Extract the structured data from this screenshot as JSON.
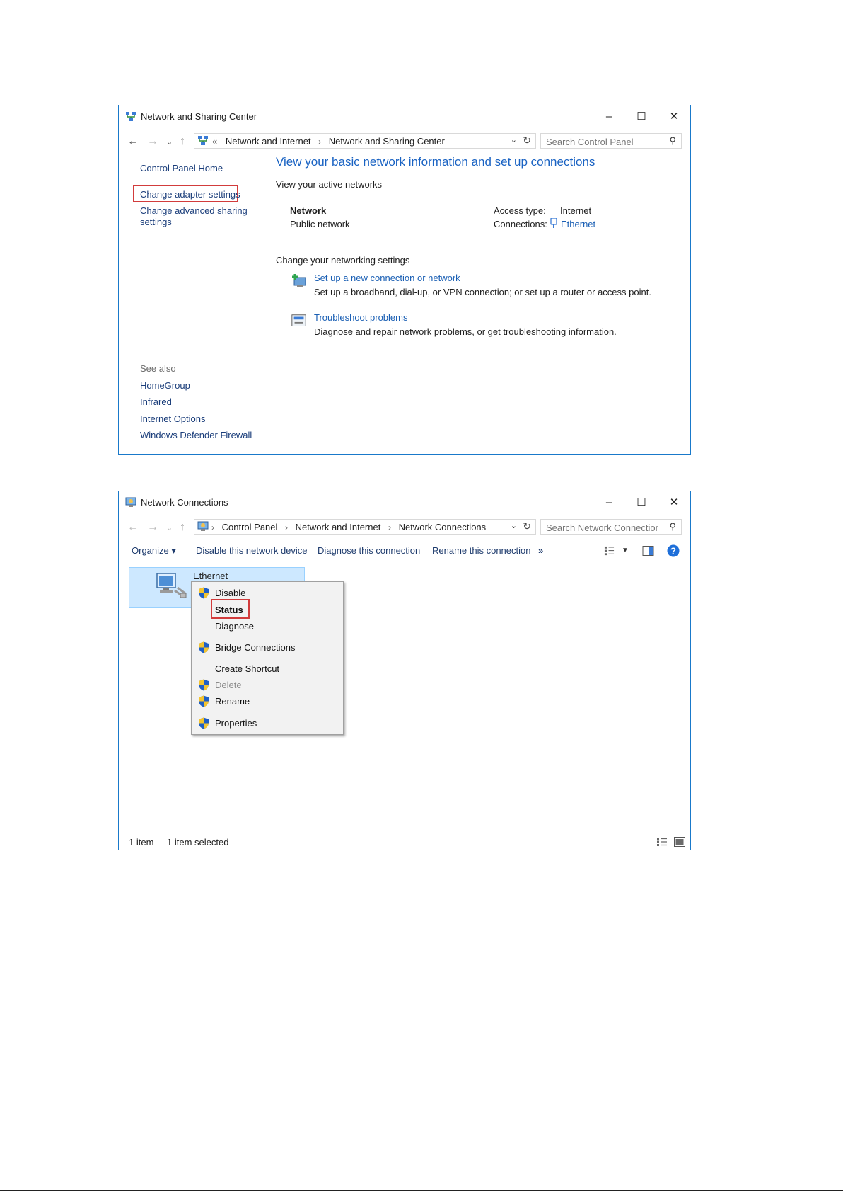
{
  "window1": {
    "title": "Network and Sharing Center",
    "breadcrumb_prefix": "«",
    "breadcrumb": [
      "Network and Internet",
      "Network and Sharing Center"
    ],
    "search_placeholder": "Search Control Panel",
    "left_nav": {
      "home": "Control Panel Home",
      "change_adapter": "Change adapter settings",
      "change_advanced_line1": "Change advanced sharing",
      "change_advanced_line2": "settings"
    },
    "see_also": {
      "label": "See also",
      "items": [
        "HomeGroup",
        "Infrared",
        "Internet Options",
        "Windows Defender Firewall"
      ]
    },
    "main_heading": "View your basic network information and set up connections",
    "active_networks_label": "View your active networks",
    "network": {
      "name": "Network",
      "type": "Public network",
      "access_type_label": "Access type:",
      "access_type_value": "Internet",
      "connections_label": "Connections:",
      "connections_value": "Ethernet"
    },
    "change_settings_label": "Change your networking settings",
    "tasks": [
      {
        "title": "Set up a new connection or network",
        "desc": "Set up a broadband, dial-up, or VPN connection; or set up a router or access point."
      },
      {
        "title": "Troubleshoot problems",
        "desc": "Diagnose and repair network problems, or get troubleshooting information."
      }
    ]
  },
  "window2": {
    "title": "Network Connections",
    "breadcrumb": [
      "Control Panel",
      "Network and Internet",
      "Network Connections"
    ],
    "search_placeholder": "Search Network Connections",
    "toolbar": {
      "organize": "Organize ▾",
      "disable": "Disable this network device",
      "diagnose": "Diagnose this connection",
      "rename": "Rename this connection",
      "more": "»"
    },
    "item_label": "Ethernet",
    "context_menu": {
      "disable": "Disable",
      "status": "Status",
      "diagnose": "Diagnose",
      "bridge": "Bridge Connections",
      "shortcut": "Create Shortcut",
      "delete": "Delete",
      "rename": "Rename",
      "properties": "Properties"
    },
    "status_bar": {
      "count": "1 item",
      "selected": "1 item selected"
    }
  },
  "colors": {
    "window_border": "#1979ca",
    "link": "#1a5fb4",
    "highlight_box": "#d23c3c",
    "selection": "#cde8ff"
  }
}
